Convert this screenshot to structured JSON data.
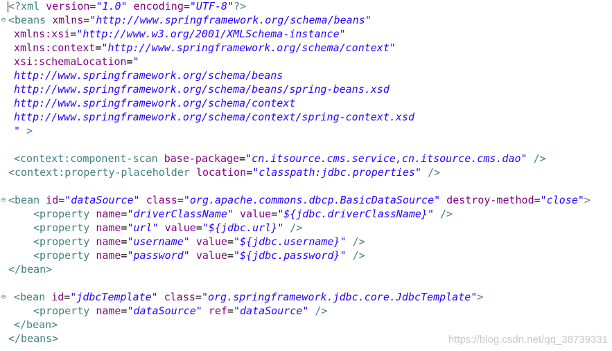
{
  "lines": [
    {
      "fold": "",
      "indent": 0,
      "tokens": [
        {
          "k": "pi",
          "t": "<?xml "
        },
        {
          "k": "attr",
          "t": "version"
        },
        {
          "k": "eq",
          "t": "="
        },
        {
          "k": "val",
          "t": "\"1.0\""
        },
        {
          "k": "text",
          "t": " "
        },
        {
          "k": "attr",
          "t": "encoding"
        },
        {
          "k": "eq",
          "t": "="
        },
        {
          "k": "val",
          "t": "\"UTF-8\""
        },
        {
          "k": "pi",
          "t": "?>"
        }
      ]
    },
    {
      "fold": "⊖",
      "indent": 0,
      "tokens": [
        {
          "k": "tag",
          "t": "<beans "
        },
        {
          "k": "attr",
          "t": "xmlns"
        },
        {
          "k": "eq",
          "t": "="
        },
        {
          "k": "val",
          "t": "\"http://www.springframework.org/schema/beans\""
        }
      ]
    },
    {
      "fold": "",
      "indent": 1,
      "tokens": [
        {
          "k": "attr",
          "t": "xmlns:xsi"
        },
        {
          "k": "eq",
          "t": "="
        },
        {
          "k": "val",
          "t": "\"http://www.w3.org/2001/XMLSchema-instance\""
        }
      ]
    },
    {
      "fold": "",
      "indent": 1,
      "tokens": [
        {
          "k": "attr",
          "t": "xmlns:context"
        },
        {
          "k": "eq",
          "t": "="
        },
        {
          "k": "val",
          "t": "\"http://www.springframework.org/schema/context\""
        }
      ]
    },
    {
      "fold": "",
      "indent": 1,
      "tokens": [
        {
          "k": "attr",
          "t": "xsi:schemaLocation"
        },
        {
          "k": "eq",
          "t": "="
        },
        {
          "k": "val",
          "t": "\""
        }
      ]
    },
    {
      "fold": "",
      "indent": 1,
      "tokens": [
        {
          "k": "val",
          "t": "http://www.springframework.org/schema/beans"
        }
      ]
    },
    {
      "fold": "",
      "indent": 1,
      "tokens": [
        {
          "k": "val",
          "t": "http://www.springframework.org/schema/beans/spring-beans.xsd"
        }
      ]
    },
    {
      "fold": "",
      "indent": 1,
      "tokens": [
        {
          "k": "val",
          "t": "http://www.springframework.org/schema/context"
        }
      ]
    },
    {
      "fold": "",
      "indent": 1,
      "tokens": [
        {
          "k": "val",
          "t": "http://www.springframework.org/schema/context/spring-context.xsd"
        }
      ]
    },
    {
      "fold": "",
      "indent": 1,
      "tokens": [
        {
          "k": "val",
          "t": "\""
        },
        {
          "k": "tag",
          "t": " >"
        }
      ]
    },
    {
      "fold": "",
      "indent": 0,
      "tokens": []
    },
    {
      "fold": "",
      "indent": 1,
      "tokens": [
        {
          "k": "tag",
          "t": "<context:component-scan "
        },
        {
          "k": "attr",
          "t": "base-package"
        },
        {
          "k": "eq",
          "t": "="
        },
        {
          "k": "val",
          "t": "\"cn.itsource.cms.service,cn.itsource.cms.dao\""
        },
        {
          "k": "tag",
          "t": " />"
        }
      ]
    },
    {
      "fold": "",
      "indent": 0,
      "tokens": [
        {
          "k": "tag",
          "t": "<context:property-placeholder "
        },
        {
          "k": "attr",
          "t": "location"
        },
        {
          "k": "eq",
          "t": "="
        },
        {
          "k": "val",
          "t": "\"classpath:jdbc.properties\""
        },
        {
          "k": "tag",
          "t": " />"
        }
      ]
    },
    {
      "fold": "",
      "indent": 0,
      "tokens": []
    },
    {
      "fold": "⊖",
      "indent": 0,
      "tokens": [
        {
          "k": "tag",
          "t": "<bean "
        },
        {
          "k": "attr",
          "t": "id"
        },
        {
          "k": "eq",
          "t": "="
        },
        {
          "k": "val",
          "t": "\"dataSource\""
        },
        {
          "k": "text",
          "t": " "
        },
        {
          "k": "attr",
          "t": "class"
        },
        {
          "k": "eq",
          "t": "="
        },
        {
          "k": "val",
          "t": "\"org.apache.commons.dbcp.BasicDataSource\""
        },
        {
          "k": "text",
          "t": " "
        },
        {
          "k": "attr",
          "t": "destroy-method"
        },
        {
          "k": "eq",
          "t": "="
        },
        {
          "k": "val",
          "t": "\"close\""
        },
        {
          "k": "tag",
          "t": ">"
        }
      ]
    },
    {
      "fold": "",
      "indent": 2,
      "tokens": [
        {
          "k": "tag",
          "t": "<property "
        },
        {
          "k": "attr",
          "t": "name"
        },
        {
          "k": "eq",
          "t": "="
        },
        {
          "k": "val",
          "t": "\"driverClassName\""
        },
        {
          "k": "text",
          "t": " "
        },
        {
          "k": "attr",
          "t": "value"
        },
        {
          "k": "eq",
          "t": "="
        },
        {
          "k": "val",
          "t": "\"${jdbc.driverClassName}\""
        },
        {
          "k": "tag",
          "t": " />"
        }
      ]
    },
    {
      "fold": "",
      "indent": 2,
      "tokens": [
        {
          "k": "tag",
          "t": "<property "
        },
        {
          "k": "attr",
          "t": "name"
        },
        {
          "k": "eq",
          "t": "="
        },
        {
          "k": "val",
          "t": "\"url\""
        },
        {
          "k": "text",
          "t": " "
        },
        {
          "k": "attr",
          "t": "value"
        },
        {
          "k": "eq",
          "t": "="
        },
        {
          "k": "val",
          "t": "\"${jdbc.url}\""
        },
        {
          "k": "tag",
          "t": " />"
        }
      ]
    },
    {
      "fold": "",
      "indent": 2,
      "tokens": [
        {
          "k": "tag",
          "t": "<property "
        },
        {
          "k": "attr",
          "t": "name"
        },
        {
          "k": "eq",
          "t": "="
        },
        {
          "k": "val",
          "t": "\"username\""
        },
        {
          "k": "text",
          "t": " "
        },
        {
          "k": "attr",
          "t": "value"
        },
        {
          "k": "eq",
          "t": "="
        },
        {
          "k": "val",
          "t": "\"${jdbc.username}\""
        },
        {
          "k": "tag",
          "t": " />"
        }
      ]
    },
    {
      "fold": "",
      "indent": 2,
      "tokens": [
        {
          "k": "tag",
          "t": "<property "
        },
        {
          "k": "attr",
          "t": "name"
        },
        {
          "k": "eq",
          "t": "="
        },
        {
          "k": "val",
          "t": "\"password\""
        },
        {
          "k": "text",
          "t": " "
        },
        {
          "k": "attr",
          "t": "value"
        },
        {
          "k": "eq",
          "t": "="
        },
        {
          "k": "val",
          "t": "\"${jdbc.password}\""
        },
        {
          "k": "tag",
          "t": " />"
        }
      ]
    },
    {
      "fold": "",
      "indent": 0,
      "tokens": [
        {
          "k": "tag",
          "t": "</bean>"
        }
      ]
    },
    {
      "fold": "",
      "indent": 0,
      "tokens": []
    },
    {
      "fold": "⊖",
      "indent": 1,
      "tokens": [
        {
          "k": "tag",
          "t": "<bean "
        },
        {
          "k": "attr",
          "t": "id"
        },
        {
          "k": "eq",
          "t": "="
        },
        {
          "k": "val",
          "t": "\"jdbcTemplate\""
        },
        {
          "k": "text",
          "t": " "
        },
        {
          "k": "attr",
          "t": "class"
        },
        {
          "k": "eq",
          "t": "="
        },
        {
          "k": "val",
          "t": "\"org.springframework.jdbc.core.JdbcTemplate\""
        },
        {
          "k": "tag",
          "t": ">"
        }
      ]
    },
    {
      "fold": "",
      "indent": 2,
      "tokens": [
        {
          "k": "tag",
          "t": "<property "
        },
        {
          "k": "attr",
          "t": "name"
        },
        {
          "k": "eq",
          "t": "="
        },
        {
          "k": "val",
          "t": "\"dataSource\""
        },
        {
          "k": "text",
          "t": " "
        },
        {
          "k": "attr",
          "t": "ref"
        },
        {
          "k": "eq",
          "t": "="
        },
        {
          "k": "val",
          "t": "\"dataSource\""
        },
        {
          "k": "tag",
          "t": " />"
        }
      ]
    },
    {
      "fold": "",
      "indent": 1,
      "tokens": [
        {
          "k": "tag",
          "t": "</bean>"
        }
      ]
    },
    {
      "fold": "",
      "indent": 0,
      "tokens": [
        {
          "k": "tag",
          "t": "</beans>"
        }
      ]
    }
  ],
  "watermark": "https://blog.csdn.net/qq_38739331",
  "colors": {
    "tag": "#3f7f7f",
    "attribute": "#7f007f",
    "value": "#2a00ff",
    "background": "#ffffff"
  }
}
